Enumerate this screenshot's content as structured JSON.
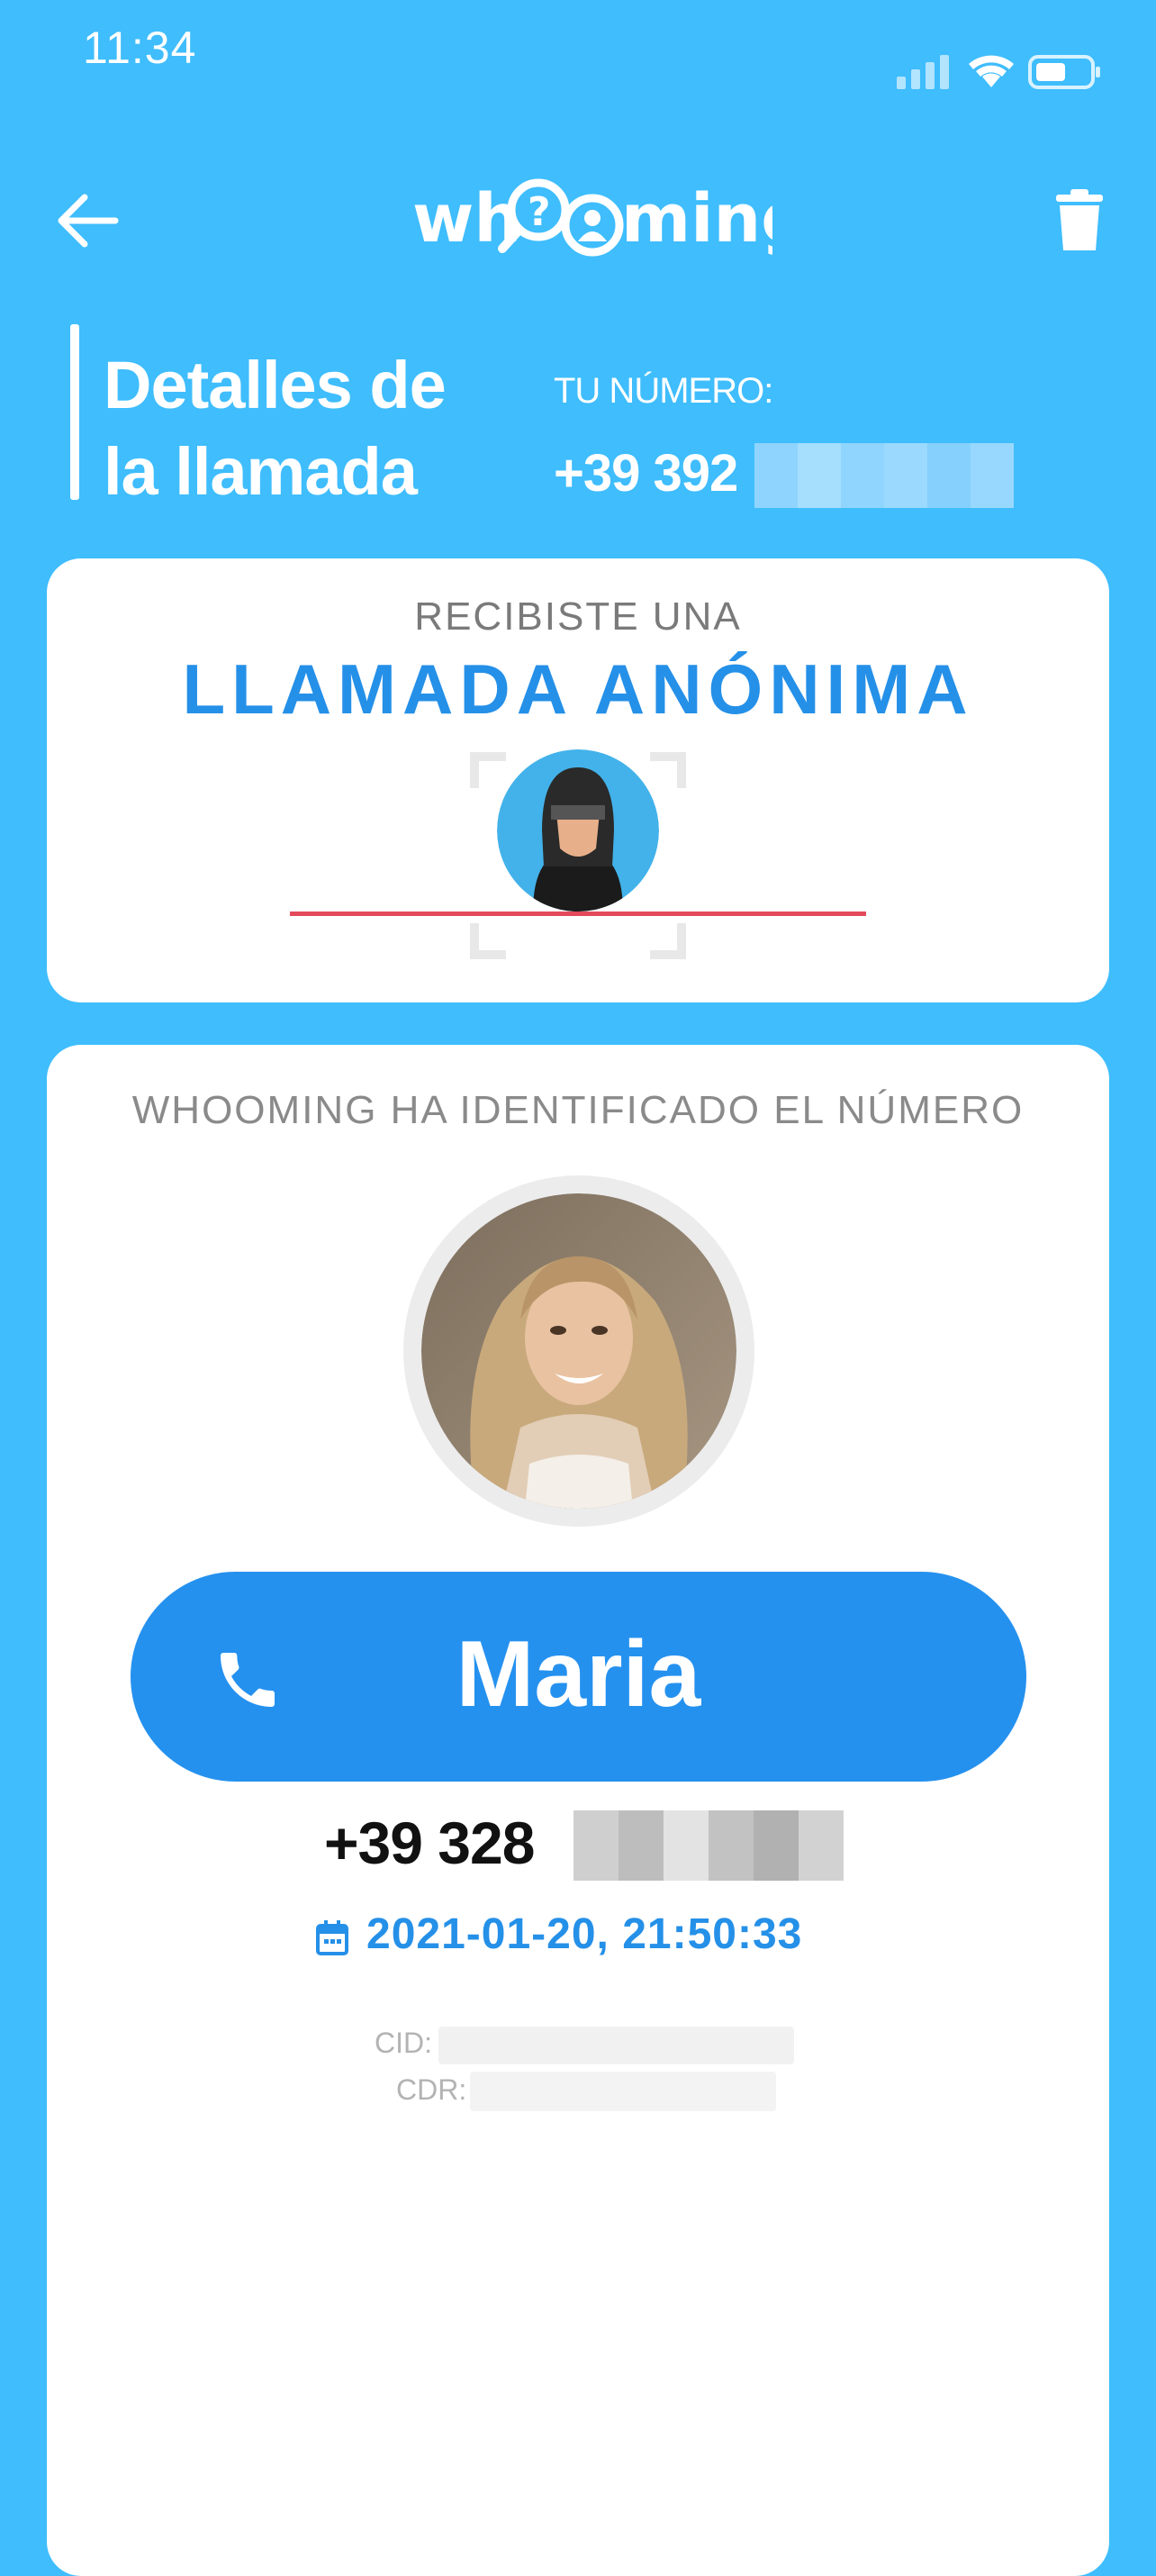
{
  "status_bar": {
    "time": "11:34"
  },
  "header": {
    "logo_text": "whooming"
  },
  "title": {
    "line1": "Detalles de",
    "line2": "la llamada"
  },
  "your_number": {
    "label": "TU NÚMERO:",
    "value": "+39 392"
  },
  "anonymous_card": {
    "subtitle": "RECIBISTE UNA",
    "title": "LLAMADA ANÓNIMA"
  },
  "identified_card": {
    "subtitle": "WHOOMING HA IDENTIFICADO EL NÚMERO",
    "name": "Maria",
    "number": "+39 328",
    "datetime": "2021-01-20, 21:50:33",
    "cid_label": "CID:",
    "cdr_label": "CDR:"
  },
  "colors": {
    "background": "#3fbdfd",
    "accent": "#2591ef",
    "alert_line": "#e24a5a"
  }
}
